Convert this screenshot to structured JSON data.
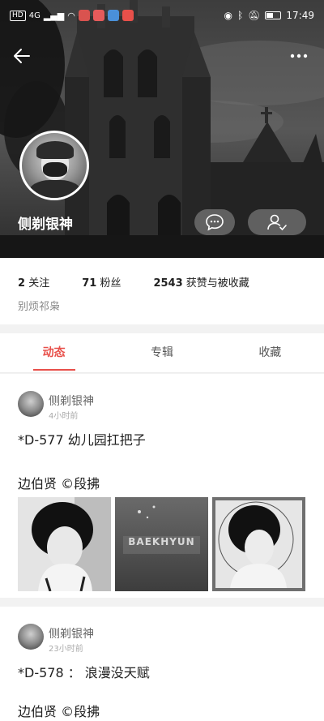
{
  "status_bar": {
    "network_badge": "HD",
    "signal": "4G",
    "time": "17:49"
  },
  "header": {
    "back_icon": "arrow-left-icon",
    "more_icon": "more-dots-icon",
    "username": "侧剃银神"
  },
  "profile": {
    "following": {
      "count": "2",
      "label": "关注"
    },
    "fans": {
      "count": "71",
      "label": "粉丝"
    },
    "likes": {
      "count": "2543",
      "label": "获赞与被收藏"
    },
    "bio": "别烦祁枭"
  },
  "tabs": [
    {
      "label": "动态",
      "active": true
    },
    {
      "label": "专辑",
      "active": false
    },
    {
      "label": "收藏",
      "active": false
    }
  ],
  "posts": [
    {
      "author": "侧剃银神",
      "time": "4小时前",
      "title": "*D-577  幼儿园扛把子",
      "subtitle": "边伯贤 ©段拂",
      "thumbs": [
        {
          "watermark": ""
        },
        {
          "watermark": "BAEKHYUN"
        },
        {
          "watermark": ""
        }
      ]
    },
    {
      "author": "侧剃银神",
      "time": "23小时前",
      "title": "*D-578 ： 浪漫没天赋",
      "subtitle": "边伯贤 ©段拂"
    }
  ],
  "colors": {
    "accent": "#e8504a",
    "cover_dark": "#1e1e1e"
  }
}
